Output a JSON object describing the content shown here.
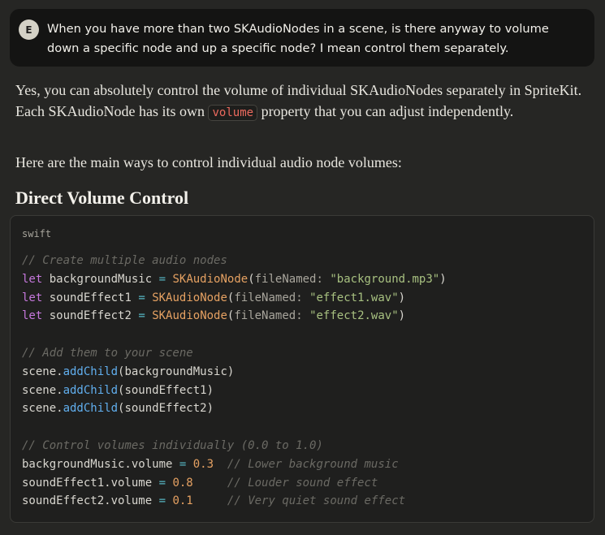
{
  "user_message": {
    "avatar_initial": "E",
    "text": "When you have more than two SKAudioNodes in a scene, is there anyway to volume down a specific node and up a specific node? I mean control them separately."
  },
  "answer": {
    "p1_before": "Yes, you can absolutely control the volume of individual SKAudioNodes separately in SpriteKit. Each SKAudioNode has its own ",
    "p1_code": "volume",
    "p1_after": " property that you can adjust independently.",
    "p2": "Here are the main ways to control individual audio node volumes:",
    "heading": "Direct Volume Control"
  },
  "code_block": {
    "language": "swift",
    "lines": [
      [
        {
          "t": "// Create multiple audio nodes",
          "c": "cm"
        }
      ],
      [
        {
          "t": "let",
          "c": "kw"
        },
        {
          "t": " backgroundMusic ",
          "c": ""
        },
        {
          "t": "=",
          "c": "op"
        },
        {
          "t": " ",
          "c": ""
        },
        {
          "t": "SKAudioNode",
          "c": "ty"
        },
        {
          "t": "(",
          "c": ""
        },
        {
          "t": "fileNamed:",
          "c": "pa"
        },
        {
          "t": " ",
          "c": ""
        },
        {
          "t": "\"background.mp3\"",
          "c": "str"
        },
        {
          "t": ")",
          "c": ""
        }
      ],
      [
        {
          "t": "let",
          "c": "kw"
        },
        {
          "t": " soundEffect1 ",
          "c": ""
        },
        {
          "t": "=",
          "c": "op"
        },
        {
          "t": " ",
          "c": ""
        },
        {
          "t": "SKAudioNode",
          "c": "ty"
        },
        {
          "t": "(",
          "c": ""
        },
        {
          "t": "fileNamed:",
          "c": "pa"
        },
        {
          "t": " ",
          "c": ""
        },
        {
          "t": "\"effect1.wav\"",
          "c": "str"
        },
        {
          "t": ")",
          "c": ""
        }
      ],
      [
        {
          "t": "let",
          "c": "kw"
        },
        {
          "t": " soundEffect2 ",
          "c": ""
        },
        {
          "t": "=",
          "c": "op"
        },
        {
          "t": " ",
          "c": ""
        },
        {
          "t": "SKAudioNode",
          "c": "ty"
        },
        {
          "t": "(",
          "c": ""
        },
        {
          "t": "fileNamed:",
          "c": "pa"
        },
        {
          "t": " ",
          "c": ""
        },
        {
          "t": "\"effect2.wav\"",
          "c": "str"
        },
        {
          "t": ")",
          "c": ""
        }
      ],
      [],
      [
        {
          "t": "// Add them to your scene",
          "c": "cm"
        }
      ],
      [
        {
          "t": "scene.",
          "c": ""
        },
        {
          "t": "addChild",
          "c": "fn"
        },
        {
          "t": "(backgroundMusic)",
          "c": ""
        }
      ],
      [
        {
          "t": "scene.",
          "c": ""
        },
        {
          "t": "addChild",
          "c": "fn"
        },
        {
          "t": "(soundEffect1)",
          "c": ""
        }
      ],
      [
        {
          "t": "scene.",
          "c": ""
        },
        {
          "t": "addChild",
          "c": "fn"
        },
        {
          "t": "(soundEffect2)",
          "c": ""
        }
      ],
      [],
      [
        {
          "t": "// Control volumes individually (0.0 to 1.0)",
          "c": "cm"
        }
      ],
      [
        {
          "t": "backgroundMusic.volume ",
          "c": ""
        },
        {
          "t": "=",
          "c": "op"
        },
        {
          "t": " ",
          "c": ""
        },
        {
          "t": "0.3",
          "c": "num"
        },
        {
          "t": "  ",
          "c": ""
        },
        {
          "t": "// Lower background music",
          "c": "cm"
        }
      ],
      [
        {
          "t": "soundEffect1.volume ",
          "c": ""
        },
        {
          "t": "=",
          "c": "op"
        },
        {
          "t": " ",
          "c": ""
        },
        {
          "t": "0.8",
          "c": "num"
        },
        {
          "t": "     ",
          "c": ""
        },
        {
          "t": "// Louder sound effect",
          "c": "cm"
        }
      ],
      [
        {
          "t": "soundEffect2.volume ",
          "c": ""
        },
        {
          "t": "=",
          "c": "op"
        },
        {
          "t": " ",
          "c": ""
        },
        {
          "t": "0.1",
          "c": "num"
        },
        {
          "t": "     ",
          "c": ""
        },
        {
          "t": "// Very quiet sound effect",
          "c": "cm"
        }
      ]
    ]
  }
}
